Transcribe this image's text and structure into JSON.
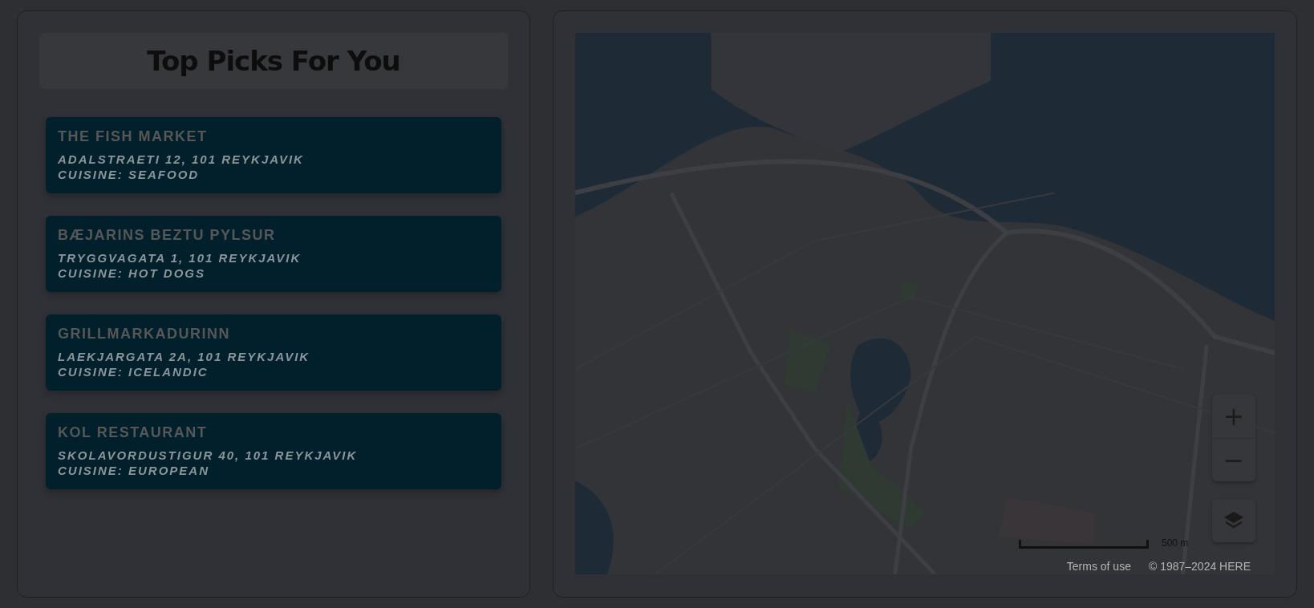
{
  "picks": {
    "title": "Top Picks For You",
    "restaurants": [
      {
        "name": "THE FISH MARKET",
        "address": "ADALSTRAETI 12, 101 REYKJAVIK",
        "cuisine": "CUISINE: SEAFOOD"
      },
      {
        "name": "BÆJARINS BEZTU PYLSUR",
        "address": "TRYGGVAGATA 1, 101 REYKJAVIK",
        "cuisine": "CUISINE: HOT DOGS"
      },
      {
        "name": "GRILLMARKADURINN",
        "address": "LAEKJARGATA 2A, 101 REYKJAVIK",
        "cuisine": "CUISINE: ICELANDIC"
      },
      {
        "name": "KOL RESTAURANT",
        "address": "SKOLAVORDUSTIGUR 40, 101 REYKJAVIK",
        "cuisine": "CUISINE: EUROPEAN"
      }
    ]
  },
  "map": {
    "zoom_in": "+",
    "zoom_out": "−",
    "scale": "500 m",
    "terms": "Terms of use",
    "copyright": "© 1987–2024 HERE"
  }
}
